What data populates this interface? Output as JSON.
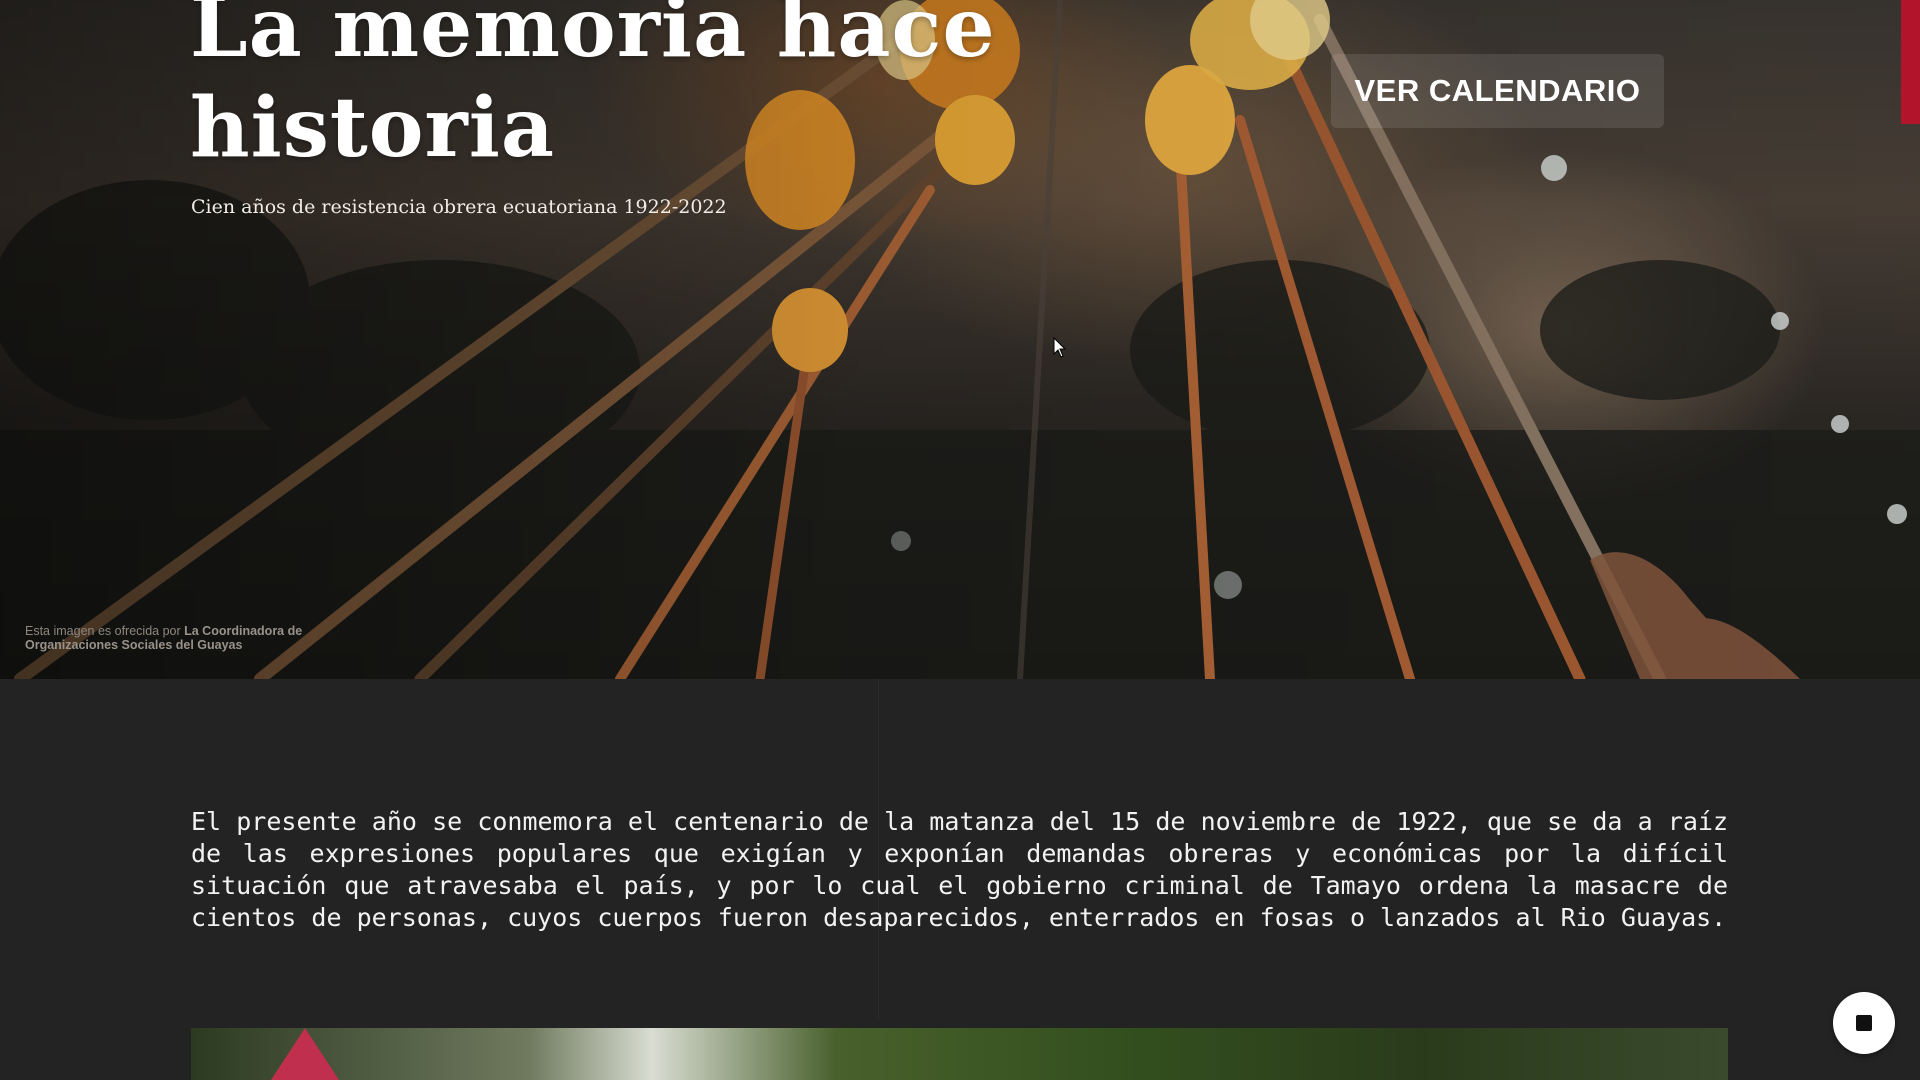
{
  "hero": {
    "title": "La memoria hace\nhistoria",
    "subtitle": "Cien años de resistencia obrera ecuatoriana 1922-2022",
    "cta_label": "VER CALENDARIO",
    "credit_prefix": "Esta imagen es ofrecida por ",
    "credit_org": "La Coordinadora de Organizaciones Sociales del Guayas"
  },
  "main": {
    "paragraph": "El presente año se conmemora el centenario de la matanza del 15 de noviembre de 1922, que se da a raíz de las expresiones populares que exigían y exponían demandas obreras y económicas por la difícil situación que atravesaba el país, y por lo cual el gobierno criminal de Tamayo ordena la masacre de cientos de personas, cuyos cuerpos fueron desaparecidos, enterrados en fosas o lanzados al Rio Guayas."
  },
  "colors": {
    "accent_red": "#b2142c",
    "page_background": "#232323",
    "text": "#ffffff"
  },
  "icons": {
    "stop": "stop-icon",
    "cursor": "mouse-cursor-icon"
  }
}
